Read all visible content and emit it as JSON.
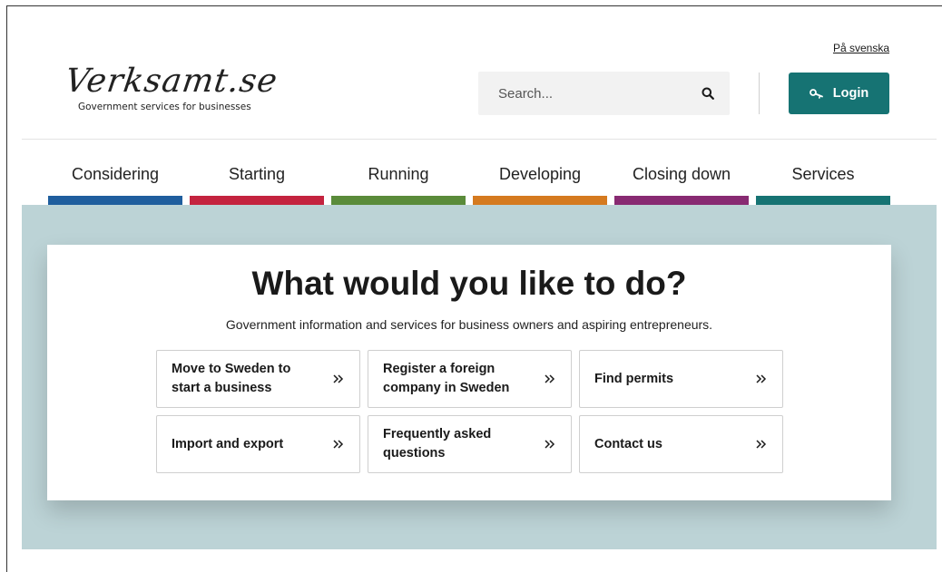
{
  "header": {
    "lang_link": "På svenska",
    "logo_script": "Verksamt.se",
    "logo_tagline": "Government services for businesses",
    "search": {
      "placeholder": "Search..."
    },
    "login_label": "Login"
  },
  "nav": {
    "items": [
      {
        "label": "Considering",
        "color": "#1f5e9e"
      },
      {
        "label": "Starting",
        "color": "#c4233f"
      },
      {
        "label": "Running",
        "color": "#5a8b3a"
      },
      {
        "label": "Developing",
        "color": "#d57a1f"
      },
      {
        "label": "Closing down",
        "color": "#882a72"
      },
      {
        "label": "Services",
        "color": "#167373"
      }
    ]
  },
  "main": {
    "title": "What would you like to do?",
    "subtitle": "Government information and services for business owners and aspiring entrepreneurs.",
    "tiles": [
      {
        "label": "Move to Sweden to start a business"
      },
      {
        "label": "Register a foreign company in Sweden"
      },
      {
        "label": "Find permits"
      },
      {
        "label": "Import and export"
      },
      {
        "label": "Frequently asked questions"
      },
      {
        "label": "Contact us"
      }
    ]
  },
  "colors": {
    "accent": "#167373",
    "hero_bg": "#bcd3d6"
  },
  "icons": {
    "search": "search-icon",
    "login": "key-icon",
    "tile_arrow": "double-chevron-right-icon"
  }
}
